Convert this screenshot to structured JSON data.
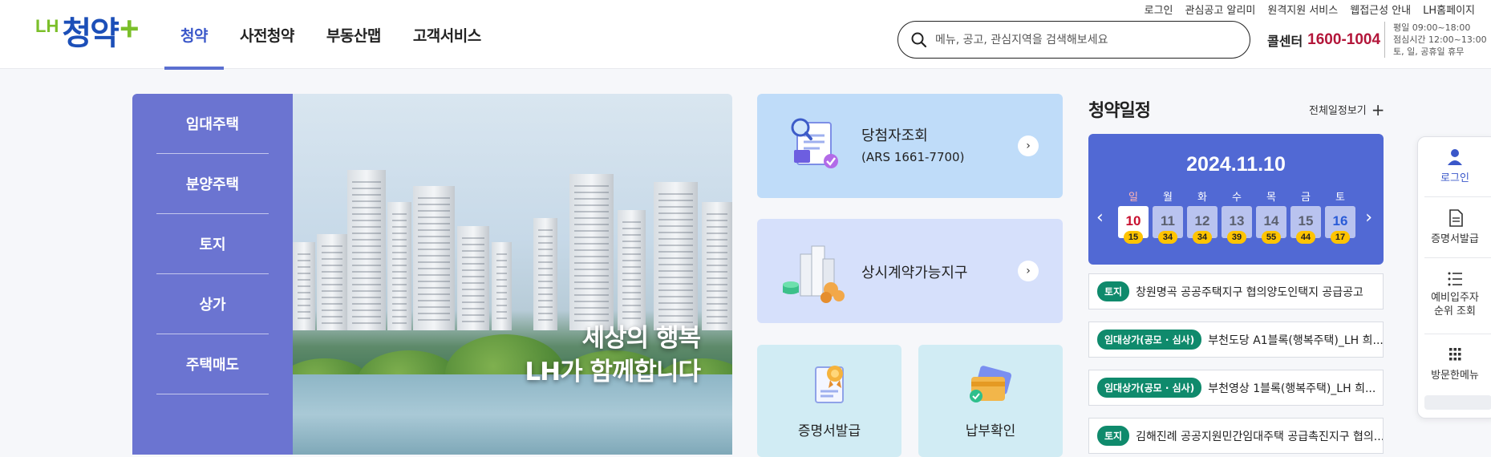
{
  "header": {
    "logo": {
      "lh": "LH",
      "name": "청약",
      "plus": "+"
    },
    "gnb": [
      {
        "label": "청약",
        "active": true
      },
      {
        "label": "사전청약",
        "active": false
      },
      {
        "label": "부동산맵",
        "active": false
      },
      {
        "label": "고객서비스",
        "active": false
      }
    ],
    "util": [
      "로그인",
      "관심공고 알리미",
      "원격지원 서비스",
      "웹접근성 안내",
      "LH홈페이지"
    ],
    "search": {
      "placeholder": "메뉴, 공고, 관심지역을 검색해보세요"
    },
    "callcenter": {
      "label": "콜센터",
      "number": "1600-1004"
    },
    "hours": [
      "평일 09:00~18:00",
      "점심시간 12:00~13:00",
      "토, 일, 공휴일 휴무"
    ]
  },
  "side_menu": [
    "임대주택",
    "분양주택",
    "토지",
    "상가",
    "주택매도"
  ],
  "hero": {
    "line1": "세상의 행복",
    "line2": "LH가 함께합니다"
  },
  "cards": {
    "winner": {
      "title": "당첨자조회",
      "sub": "(ARS 1661-7700)"
    },
    "contract": {
      "title": "상시계약가능지구"
    },
    "certificate": {
      "title": "증명서발급"
    },
    "payment": {
      "title": "납부확인"
    }
  },
  "schedule": {
    "title": "청약일정",
    "view_all": "전체일정보기",
    "date": "2024.11.10",
    "days": [
      {
        "dow": "일",
        "num": "10",
        "count": "15"
      },
      {
        "dow": "월",
        "num": "11",
        "count": "34"
      },
      {
        "dow": "화",
        "num": "12",
        "count": "34"
      },
      {
        "dow": "수",
        "num": "13",
        "count": "39"
      },
      {
        "dow": "목",
        "num": "14",
        "count": "55"
      },
      {
        "dow": "금",
        "num": "15",
        "count": "44"
      },
      {
        "dow": "토",
        "num": "16",
        "count": "17"
      }
    ],
    "notices": [
      {
        "tag": "토지",
        "text": "창원명곡 공공주택지구 협의양도인택지 공급공고"
      },
      {
        "tag": "임대상가(공모 · 심사)",
        "text": "부천도당 A1블록(행복주택)_LH 희..."
      },
      {
        "tag": "임대상가(공모 · 심사)",
        "text": "부천영상 1블록(행복주택)_LH 희..."
      },
      {
        "tag": "토지",
        "text": "김해진례 공공지원민간임대주택 공급촉진지구 협의..."
      }
    ],
    "colors": {
      "calendar": "#5169d4",
      "tag": "#0f8a6c",
      "badge": "#ffc400"
    }
  },
  "quick_menu": {
    "login": {
      "label": "로그인",
      "icon": "person-icon"
    },
    "cert": {
      "label": "증명서발급",
      "icon": "document-icon"
    },
    "rank": {
      "label1": "예비입주자",
      "label2": "순위 조회",
      "icon": "list-icon"
    },
    "visit": {
      "label": "방문한메뉴",
      "icon": "grid-icon"
    }
  }
}
